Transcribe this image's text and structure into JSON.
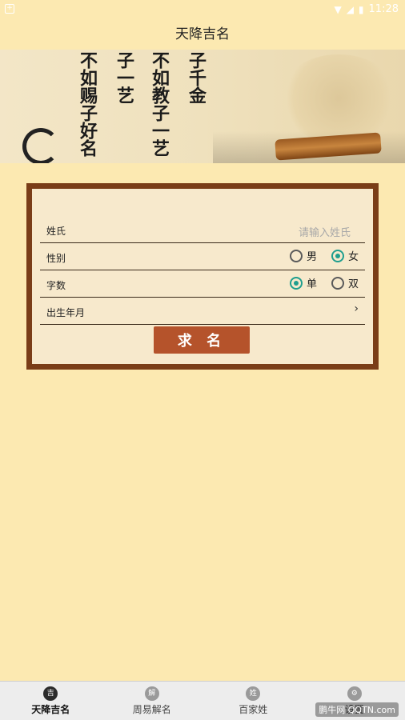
{
  "status": {
    "time": "11:28"
  },
  "title": "天降吉名",
  "banner": {
    "columns": [
      "子千金",
      "不如教子一艺",
      "子一艺",
      "不如赐子好名"
    ]
  },
  "form": {
    "surname": {
      "label": "姓氏",
      "placeholder": "请输入姓氏"
    },
    "gender": {
      "label": "性别",
      "options": [
        "男",
        "女"
      ],
      "selected": "女"
    },
    "char_count": {
      "label": "字数",
      "options": [
        "单",
        "双"
      ],
      "selected": "单"
    },
    "birth": {
      "label": "出生年月",
      "chevron": "›"
    },
    "submit": "求 名"
  },
  "nav": {
    "tabs": [
      {
        "label": "天降吉名",
        "icon": "seal-icon",
        "active": true
      },
      {
        "label": "周易解名",
        "icon": "scroll-icon",
        "active": false
      },
      {
        "label": "百家姓",
        "icon": "book-icon",
        "active": false
      },
      {
        "label": "设置",
        "icon": "gear-icon",
        "active": false
      }
    ]
  },
  "watermark": "鹏牛网 QQTN.com"
}
